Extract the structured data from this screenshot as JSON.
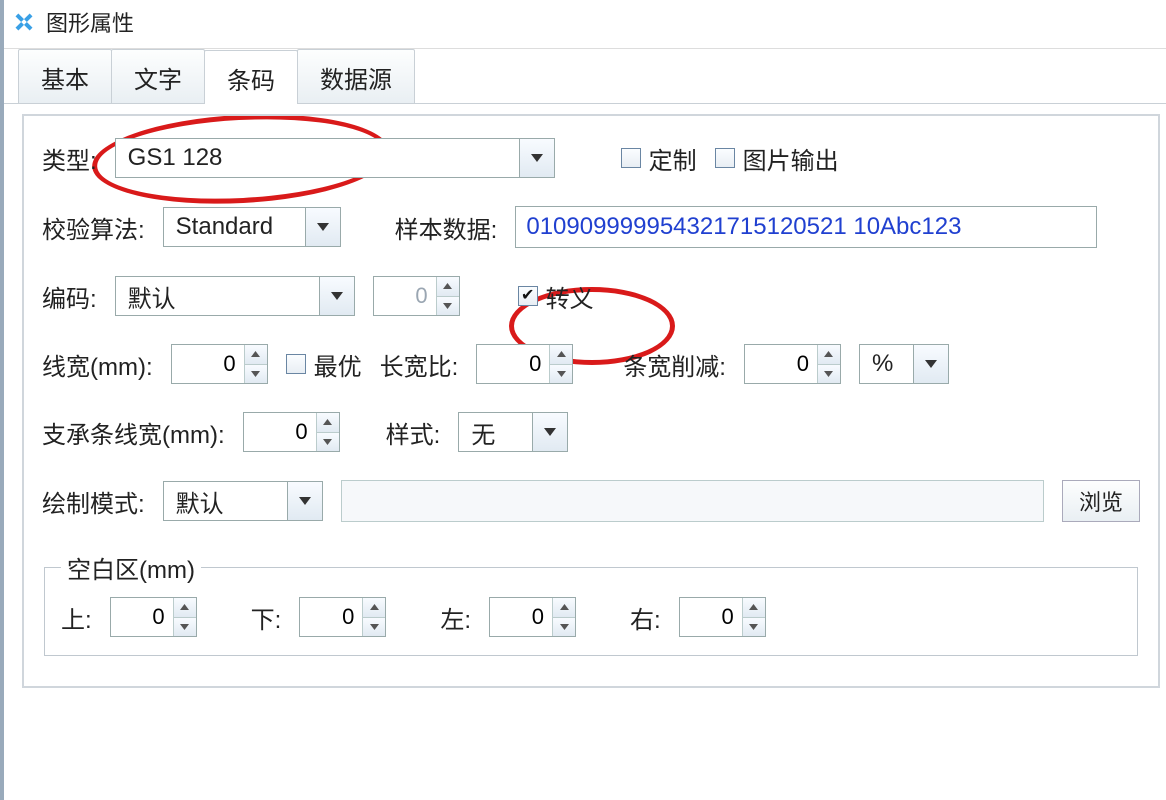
{
  "window_title": "图形属性",
  "tabs": {
    "basic": "基本",
    "text": "文字",
    "barcode": "条码",
    "datasource": "数据源"
  },
  "type_label": "类型:",
  "type_value": "GS1 128",
  "custom_label": "定制",
  "image_output_label": "图片输出",
  "check_alg_label": "校验算法:",
  "check_alg_value": "Standard",
  "sample_data_label": "样本数据:",
  "sample_data_value": "010909999954321715120521 10Abc123",
  "encoding_label": "编码:",
  "encoding_value": "默认",
  "encoding_extra_value": "0",
  "escape_label": "转义",
  "line_width_label": "线宽(mm):",
  "line_width_value": "0",
  "optimal_label": "最优",
  "aspect_label": "长宽比:",
  "aspect_value": "0",
  "bar_reduce_label": "条宽削减:",
  "bar_reduce_value": "0",
  "bar_reduce_unit": "%",
  "support_width_label": "支承条线宽(mm):",
  "support_width_value": "0",
  "style_label": "样式:",
  "style_value": "无",
  "draw_mode_label": "绘制模式:",
  "draw_mode_value": "默认",
  "browse_label": "浏览",
  "margins_title": "空白区(mm)",
  "margins": {
    "top_label": "上:",
    "top_value": "0",
    "bottom_label": "下:",
    "bottom_value": "0",
    "left_label": "左:",
    "left_value": "0",
    "right_label": "右:",
    "right_value": "0"
  }
}
